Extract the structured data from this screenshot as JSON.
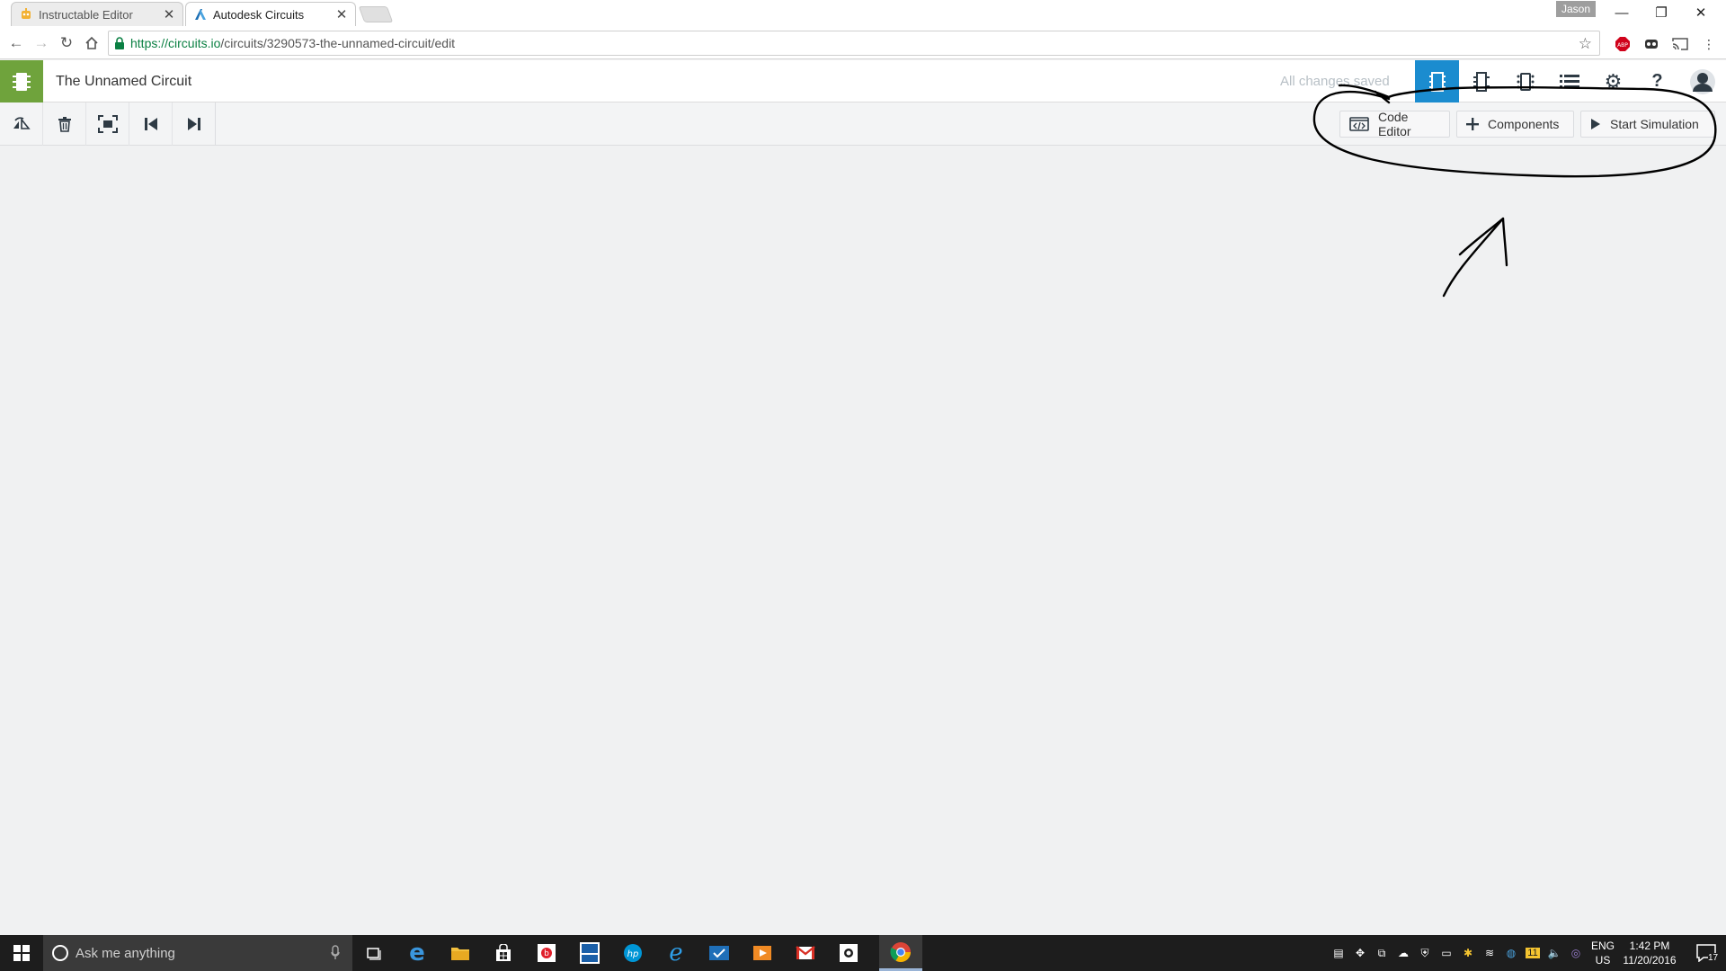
{
  "browser": {
    "tabs": [
      {
        "title": "Instructable Editor",
        "favicon": "instructables-robot-icon",
        "active": false
      },
      {
        "title": "Autodesk Circuits",
        "favicon": "autodesk-logo-icon",
        "active": true
      }
    ],
    "profile_name": "Jason",
    "url_host": "https://circuits.io",
    "url_path": "/circuits/3290573-the-unnamed-circuit/edit",
    "window_controls": [
      "minimize",
      "restore",
      "close"
    ],
    "extensions": [
      "adblock-icon",
      "ghostery-icon",
      "cast-icon",
      "menu-icon"
    ]
  },
  "app": {
    "circuit_name": "The Unnamed Circuit",
    "save_status": "All changes saved",
    "brand_color": "#6fa33c",
    "active_color": "#1b8ccf",
    "views": [
      {
        "name": "breadboard-view-icon",
        "active": true
      },
      {
        "name": "schematic-view-icon",
        "active": false
      },
      {
        "name": "pcb-view-icon",
        "active": false
      },
      {
        "name": "component-list-icon",
        "active": false
      },
      {
        "name": "settings-icon",
        "active": false
      },
      {
        "name": "help-icon",
        "active": false
      },
      {
        "name": "user-avatar-icon",
        "active": false
      }
    ],
    "tools": [
      "rotate-icon",
      "delete-icon",
      "zoom-fit-icon",
      "step-back-icon",
      "step-forward-icon"
    ],
    "actions": {
      "code_editor": "Code Editor",
      "components": "Components",
      "start_simulation": "Start Simulation"
    }
  },
  "taskbar": {
    "search_placeholder": "Ask me anything",
    "language": "ENG",
    "region": "US",
    "time": "1:42 PM",
    "date": "11/20/2016",
    "notification_count": "17",
    "battery_level": "11"
  }
}
